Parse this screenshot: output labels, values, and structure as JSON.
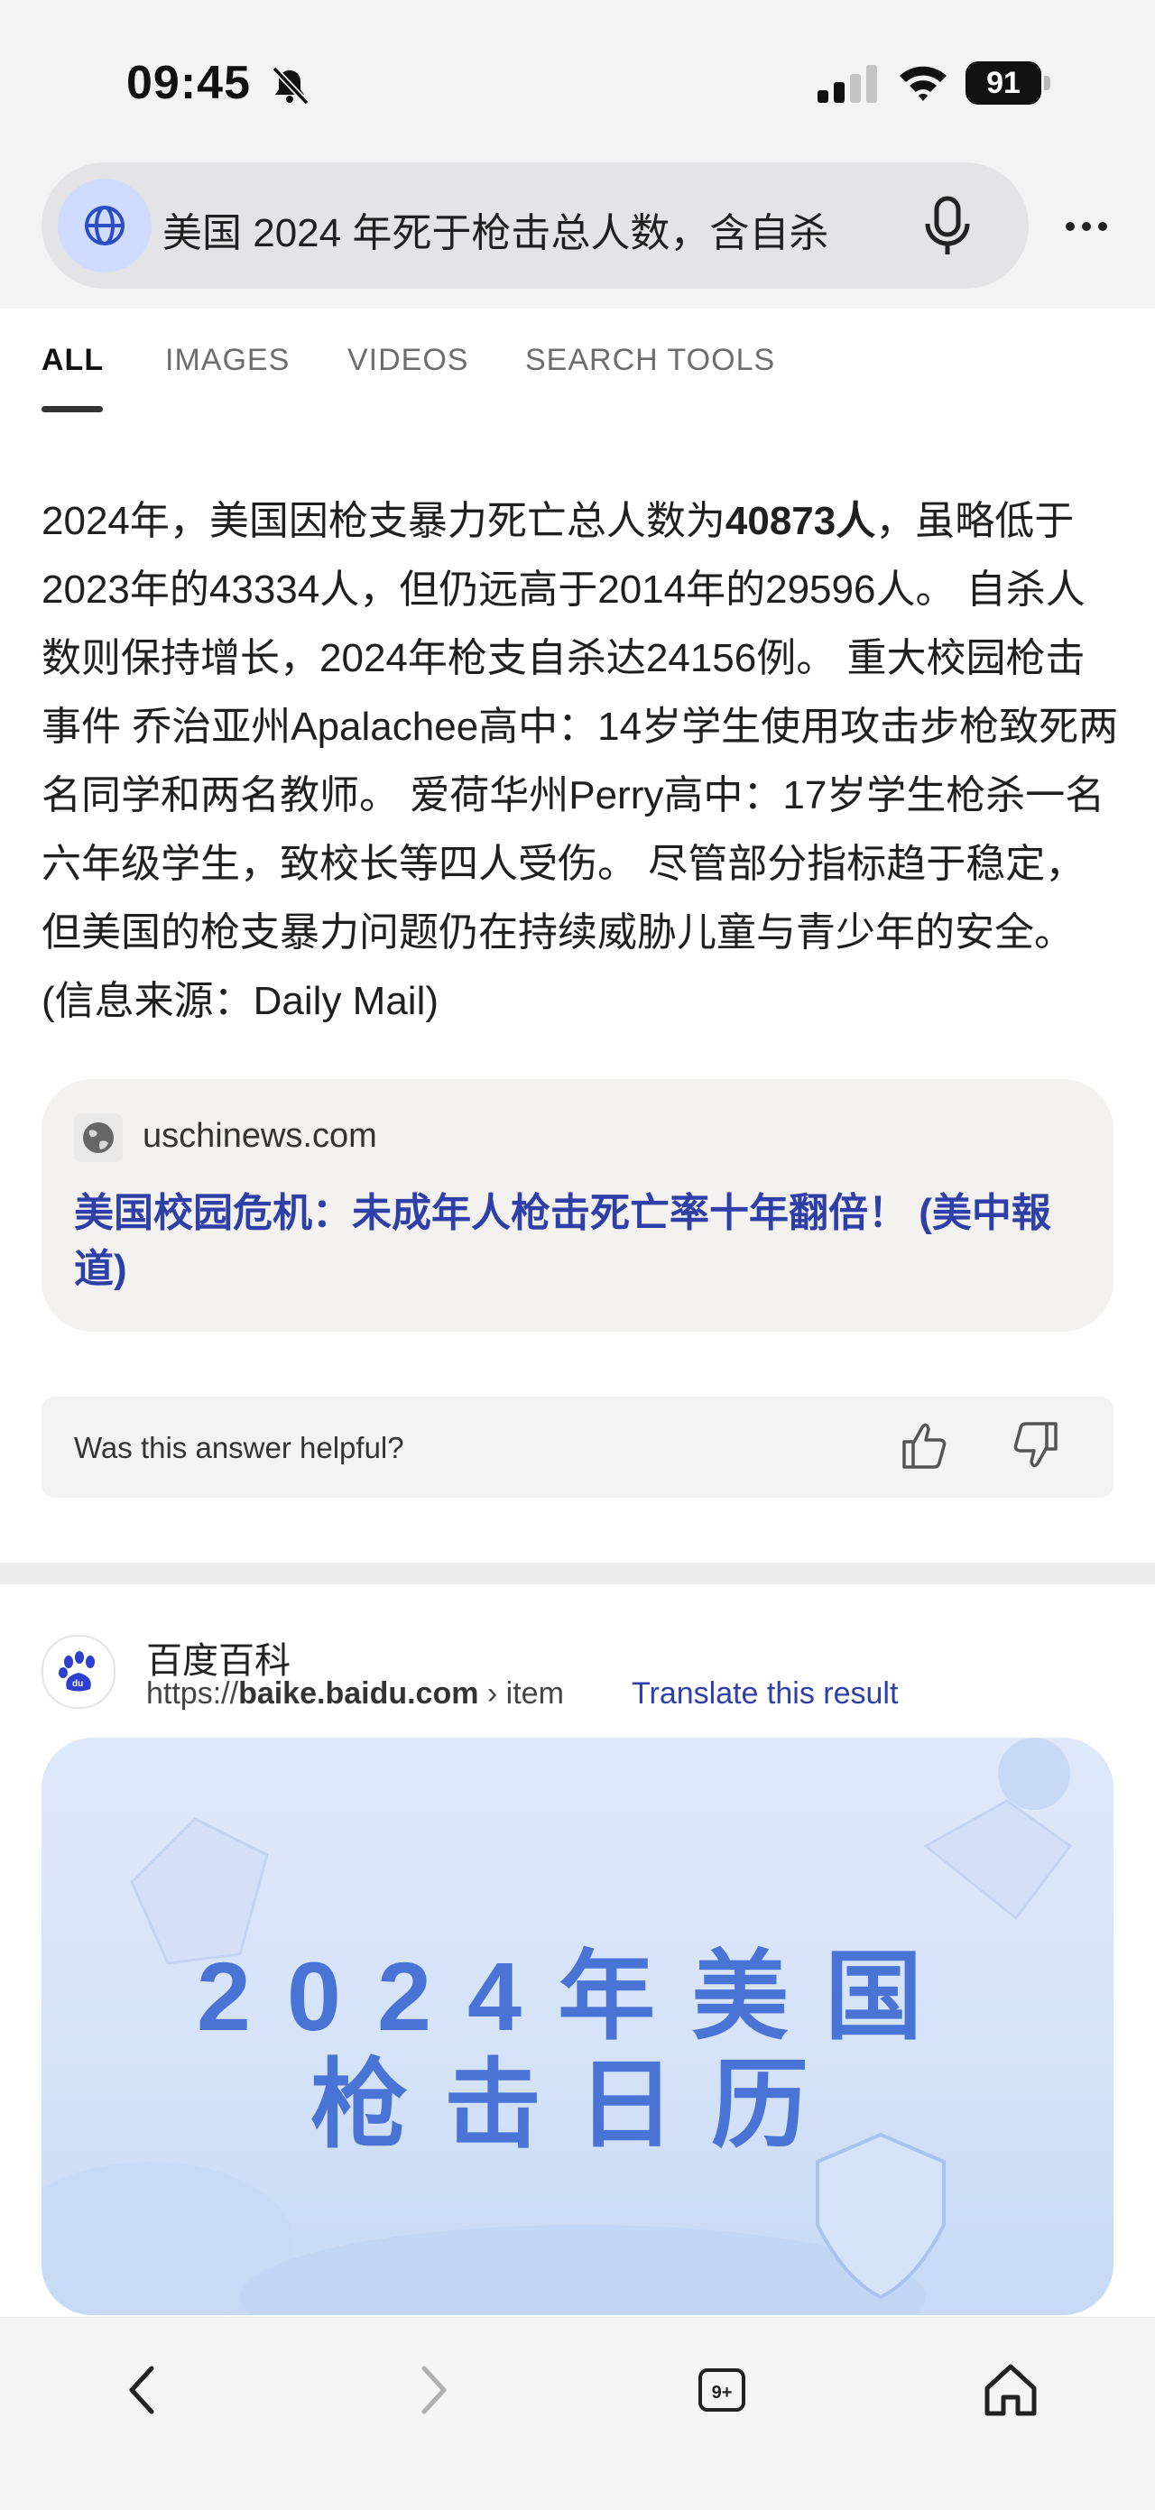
{
  "status_bar": {
    "time": "09:45",
    "battery": "91"
  },
  "search": {
    "query": "美国 2024 年死于枪击总人数，含自杀"
  },
  "tabs": [
    {
      "label": "ALL"
    },
    {
      "label": "IMAGES"
    },
    {
      "label": "VIDEOS"
    },
    {
      "label": "SEARCH TOOLS"
    }
  ],
  "answer": {
    "part1": "2024年，美国因枪支暴力死亡总人数为",
    "bold": "40873人",
    "part2": "，虽略低于2023年的43334人，但仍远高于2014年的29596人。 自杀人数则保持增长，2024年枪支自杀达24156例。 重大校园枪击事件 乔治亚州Apalachee高中：14岁学生使用攻击步枪致死两名同学和两名教师。 爱荷华州Perry高中：17岁学生枪杀一名六年级学生，致校长等四人受伤。 尽管部分指标趋于稳定，但美国的枪支暴力问题仍在持续威胁儿童与青少年的安全。 (信息来源：Daily Mail)"
  },
  "source_card": {
    "domain": "uschinews.com",
    "title": "美国校园危机：未成年人枪击死亡率十年翻倍！ (美中報道)"
  },
  "feedback": {
    "question": "Was this answer helpful?"
  },
  "result": {
    "site_name": "百度百科",
    "url_prefix": "https://",
    "url_host": "baike.baidu.com",
    "url_path": " › item",
    "translate": "Translate this result",
    "image_line1": "2024年美国",
    "image_line2": "枪击日历"
  },
  "bottom_nav": {
    "tabs_count": "9+"
  }
}
